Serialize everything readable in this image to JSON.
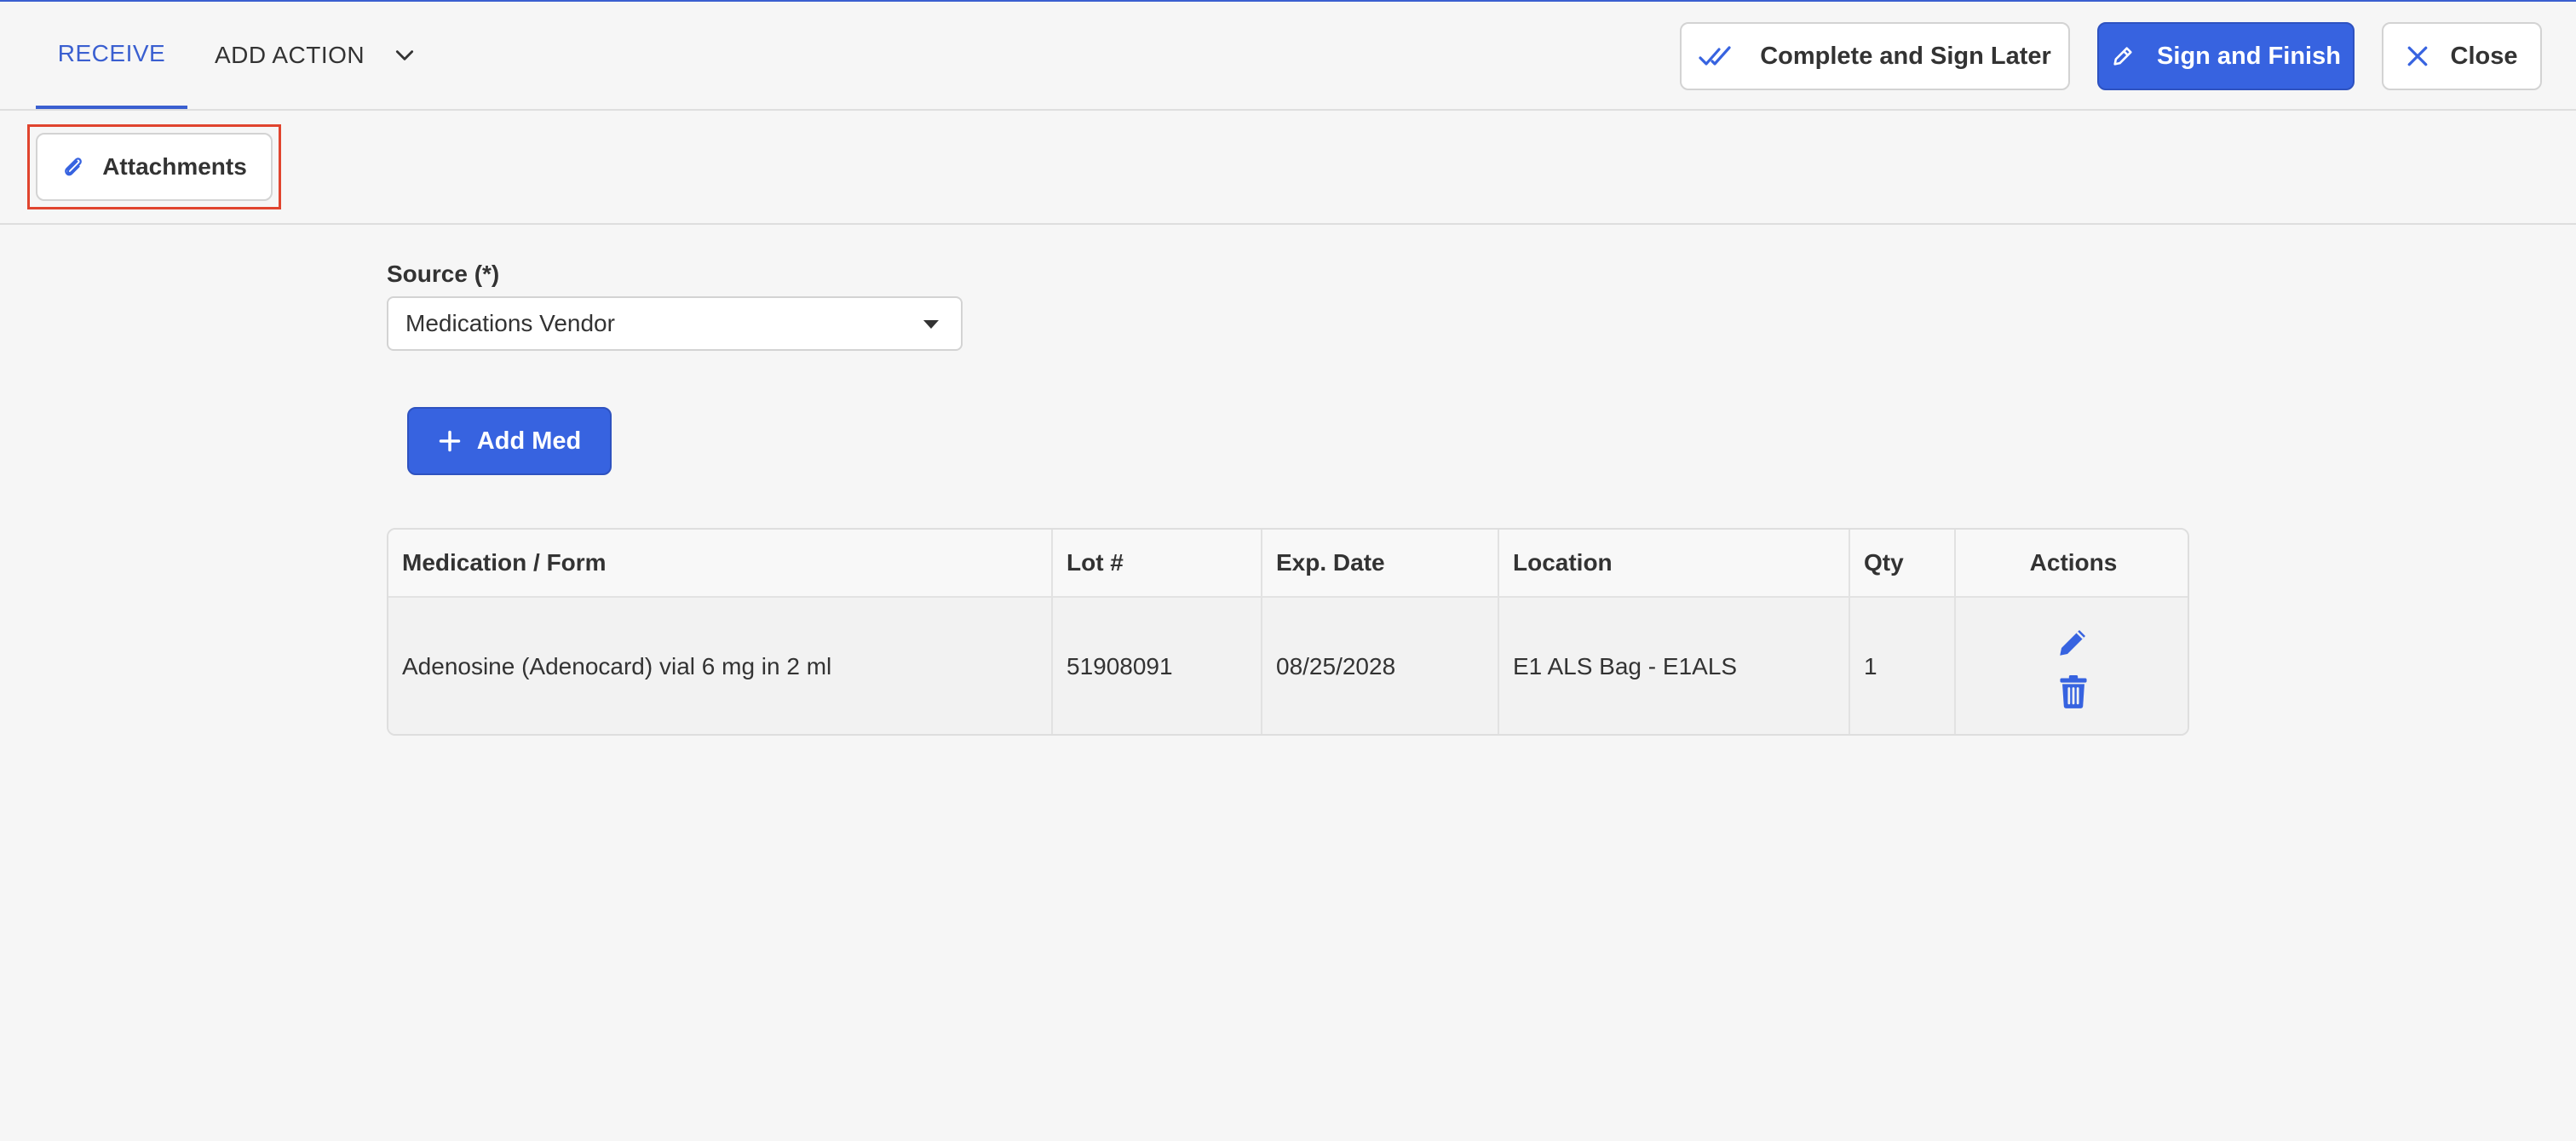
{
  "header": {
    "tabs": {
      "receive": "RECEIVE",
      "add_action": "ADD ACTION"
    },
    "buttons": {
      "complete_later": "Complete and Sign Later",
      "sign_finish": "Sign and Finish",
      "close": "Close"
    }
  },
  "subheader": {
    "attachments": "Attachments"
  },
  "form": {
    "source_label": "Source (*)",
    "source_value": "Medications Vendor",
    "add_med": "Add Med"
  },
  "table": {
    "columns": [
      "Medication / Form",
      "Lot #",
      "Exp. Date",
      "Location",
      "Qty",
      "Actions"
    ],
    "rows": [
      {
        "medication": "Adenosine (Adenocard) vial 6 mg in 2 ml",
        "lot": "51908091",
        "exp_date": "08/25/2028",
        "location": "E1 ALS Bag - E1ALS",
        "qty": "1"
      }
    ]
  },
  "icons": {
    "add_action_chevron": "chevron-down-icon",
    "complete_later": "double-check-icon",
    "sign_finish": "pen-icon",
    "close": "close-icon",
    "attachments": "paperclip-icon",
    "add_med": "plus-icon",
    "row_edit": "pencil-icon",
    "row_delete": "trash-icon"
  },
  "colors": {
    "accent": "#3763e0",
    "highlight": "#e0442e",
    "background": "#f6f6f6"
  }
}
